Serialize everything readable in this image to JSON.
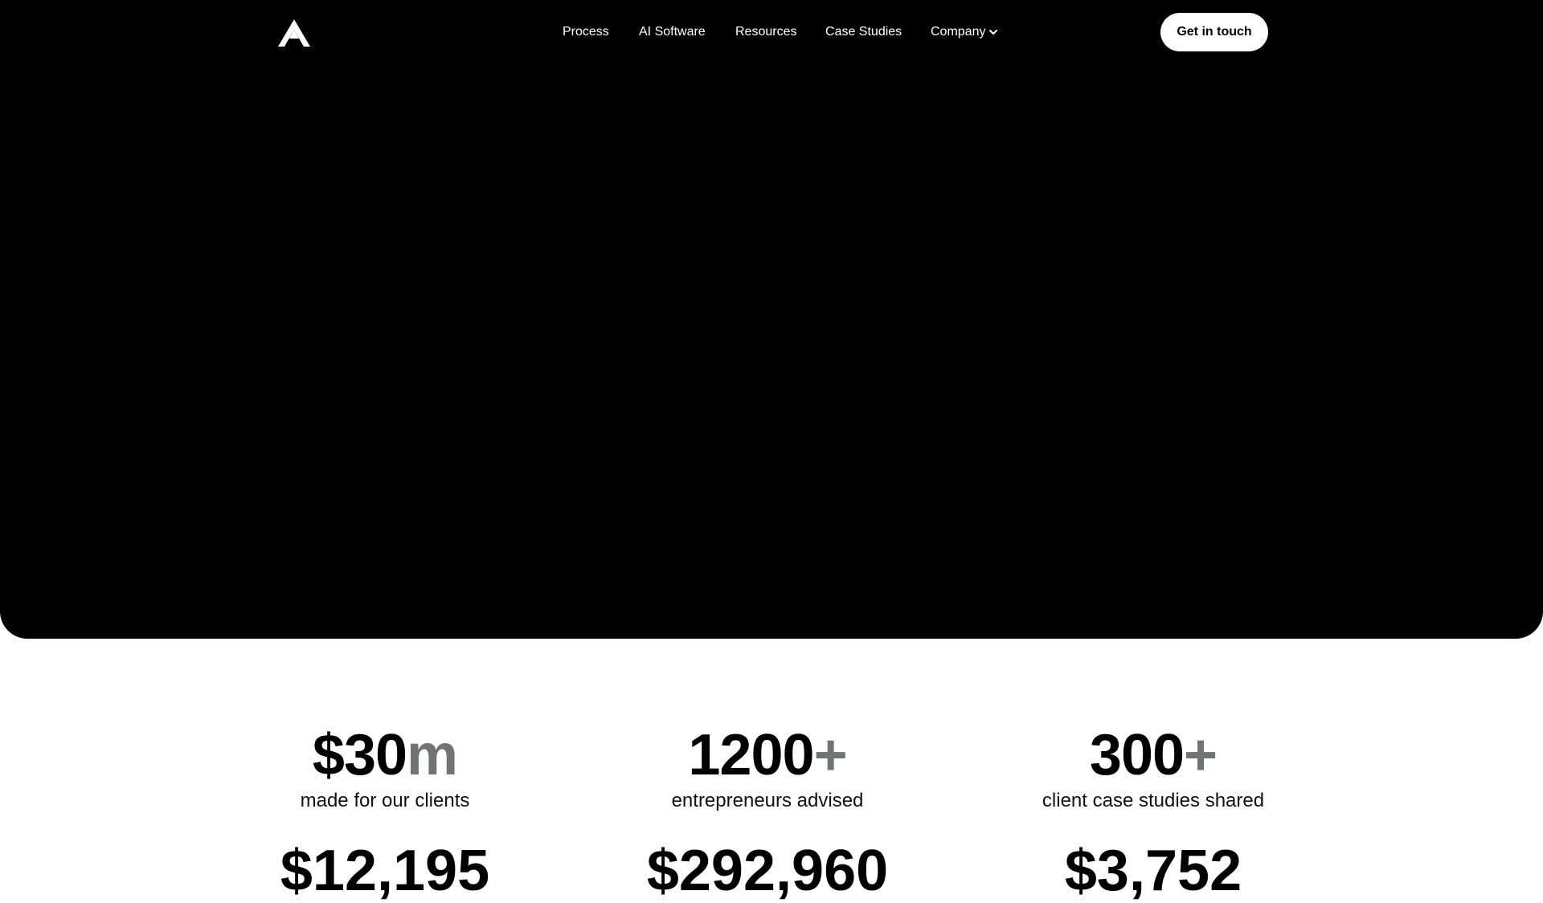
{
  "nav": {
    "items": [
      {
        "label": "Process"
      },
      {
        "label": "AI Software"
      },
      {
        "label": "Resources"
      },
      {
        "label": "Case Studies"
      },
      {
        "label": "Company"
      }
    ],
    "cta_label": "Get in touch"
  },
  "icons": {
    "logo": "logo-icon",
    "company_dropdown": "chevron-down-icon"
  },
  "colors": {
    "hero_bg": "#000000",
    "accent_muted": "#6f7475",
    "page_bg": "#ffffff"
  },
  "stats": [
    {
      "value": "$30",
      "suffix": "m",
      "label": "made for our clients"
    },
    {
      "value": "1200",
      "suffix": "+",
      "label": "entrepreneurs advised"
    },
    {
      "value": "300",
      "suffix": "+",
      "label": "client case studies shared"
    }
  ],
  "stats_row2": [
    {
      "value": "$12,195"
    },
    {
      "value": "$292,960"
    },
    {
      "value": "$3,752"
    }
  ]
}
